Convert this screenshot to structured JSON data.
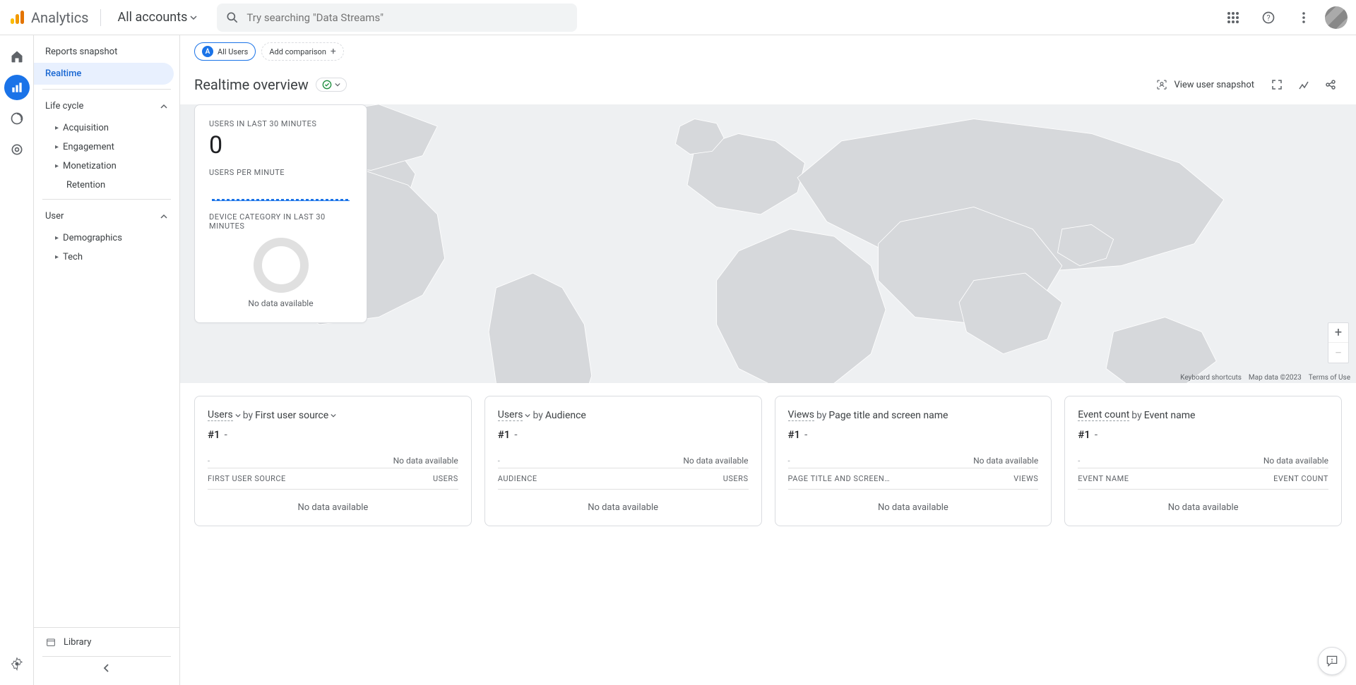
{
  "header": {
    "product": "Analytics",
    "accounts": "All accounts",
    "search_placeholder": "Try searching \"Data Streams\""
  },
  "sidebar": {
    "items": [
      {
        "label": "Reports snapshot"
      },
      {
        "label": "Realtime"
      }
    ],
    "sections": [
      {
        "label": "Life cycle",
        "items": [
          "Acquisition",
          "Engagement",
          "Monetization",
          "Retention"
        ]
      },
      {
        "label": "User",
        "items": [
          "Demographics",
          "Tech"
        ]
      }
    ],
    "library": "Library"
  },
  "topchips": {
    "all_users": "All Users",
    "add_comparison": "Add comparison"
  },
  "page": {
    "title": "Realtime overview",
    "view_snapshot": "View user snapshot"
  },
  "summary": {
    "users_last_30_label": "USERS IN LAST 30 MINUTES",
    "users_last_30_value": "0",
    "users_per_minute_label": "USERS PER MINUTE",
    "device_category_label": "DEVICE CATEGORY IN LAST 30 MINUTES",
    "no_data": "No data available"
  },
  "map": {
    "keyboard": "Keyboard shortcuts",
    "data": "Map data ©2023",
    "terms": "Terms of Use"
  },
  "cards": [
    {
      "metric": "Users",
      "by": "by",
      "dimension": "First user source",
      "metric_has_dropdown": true,
      "dim_has_dropdown": true,
      "rank": "#1",
      "rank_value": "-",
      "bar_dash": "-",
      "no_data": "No data available",
      "col1": "FIRST USER SOURCE",
      "col2": "USERS",
      "table_no_data": "No data available"
    },
    {
      "metric": "Users",
      "by": "by",
      "dimension": "Audience",
      "metric_has_dropdown": true,
      "dim_has_dropdown": false,
      "rank": "#1",
      "rank_value": "-",
      "bar_dash": "-",
      "no_data": "No data available",
      "col1": "AUDIENCE",
      "col2": "USERS",
      "table_no_data": "No data available"
    },
    {
      "metric": "Views",
      "by": "by",
      "dimension": "Page title and screen name",
      "metric_has_dropdown": false,
      "dim_has_dropdown": false,
      "rank": "#1",
      "rank_value": "-",
      "bar_dash": "-",
      "no_data": "No data available",
      "col1": "PAGE TITLE AND SCREEN…",
      "col2": "VIEWS",
      "table_no_data": "No data available"
    },
    {
      "metric": "Event count",
      "by": "by",
      "dimension": "Event name",
      "metric_has_dropdown": false,
      "dim_has_dropdown": false,
      "rank": "#1",
      "rank_value": "-",
      "bar_dash": "-",
      "no_data": "No data available",
      "col1": "EVENT NAME",
      "col2": "EVENT COUNT",
      "table_no_data": "No data available"
    }
  ],
  "chart_data": {
    "type": "bar",
    "title": "Users per minute (last 30 minutes)",
    "categories_count": 30,
    "values": [
      0,
      0,
      0,
      0,
      0,
      0,
      0,
      0,
      0,
      0,
      0,
      0,
      0,
      0,
      0,
      0,
      0,
      0,
      0,
      0,
      0,
      0,
      0,
      0,
      0,
      0,
      0,
      0,
      0,
      0
    ],
    "ylim": [
      0,
      1
    ]
  }
}
